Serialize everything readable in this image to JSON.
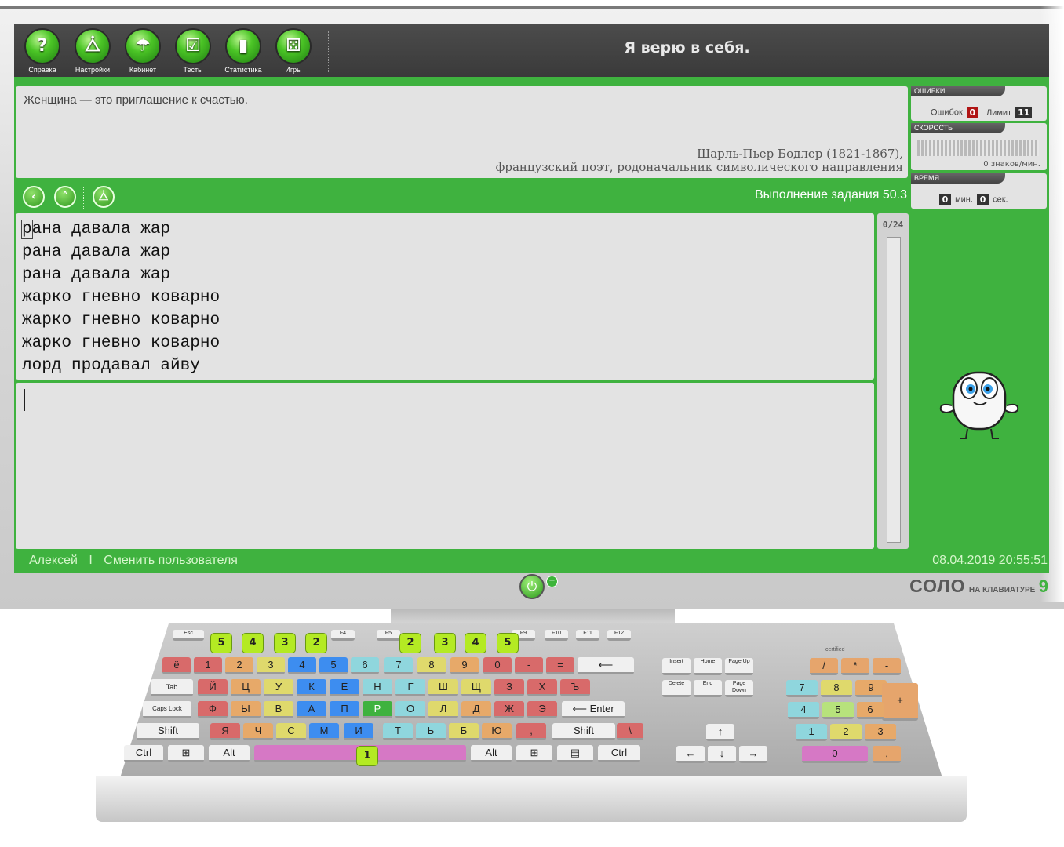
{
  "toolbar": {
    "items": [
      {
        "label": "Справка",
        "icon": "help-icon",
        "glyph": "?"
      },
      {
        "label": "Настройки",
        "icon": "metronome-icon",
        "glyph": "⧊"
      },
      {
        "label": "Кабинет",
        "icon": "lamp-icon",
        "glyph": "☂"
      },
      {
        "label": "Тесты",
        "icon": "test-check-icon",
        "glyph": "☑"
      },
      {
        "label": "Статистика",
        "icon": "chart-icon",
        "glyph": "▮"
      },
      {
        "label": "Игры",
        "icon": "dice-icon",
        "glyph": "⚄"
      }
    ],
    "motto": "Я верю в себя."
  },
  "quote": {
    "text": "Женщина — это приглашение к счастью.",
    "author_line1": "Шарль-Пьер Бодлер (1821-1867),",
    "author_line2": "французский поэт, родоначальник символического направления"
  },
  "panels": {
    "errors": {
      "title": "ОШИБКИ",
      "errors_label": "Ошибок",
      "errors_value": "0",
      "limit_label": "Лимит",
      "limit_value": "11"
    },
    "speed": {
      "title": "СКОРОСТЬ",
      "value_text": "0 знаков/мин."
    },
    "time": {
      "title": "ВРЕМЯ",
      "min_value": "0",
      "min_label": "мин.",
      "sec_value": "0",
      "sec_label": "сек."
    }
  },
  "task": {
    "progress_text": "Выполнение задания 50.3",
    "counter": "0/24",
    "lines": [
      "рана давала жар",
      "рана давала жар",
      "рана давала жар",
      "жарко гневно коварно",
      "жарко гневно коварно",
      "жарко гневно коварно",
      "лорд продавал айву"
    ],
    "first_char": "р",
    "first_line_rest": "ана давала жар"
  },
  "footer": {
    "user": "Алексей",
    "separator": "I",
    "change_user": "Сменить пользователя",
    "datetime": "08.04.2019 20:55:51"
  },
  "brand": {
    "name": "СОЛО",
    "sub": "НА КЛАВИАТУРЕ",
    "version": "9"
  },
  "keyboard": {
    "certified": "certified",
    "fingers": [
      "5",
      "4",
      "3",
      "2",
      "2",
      "3",
      "4",
      "5",
      "1"
    ],
    "row1": [
      "ё",
      "1",
      "2",
      "3",
      "4",
      "5",
      "6",
      "7",
      "8",
      "9",
      "0",
      "-",
      "="
    ],
    "row2": [
      "Й",
      "Ц",
      "У",
      "К",
      "Е",
      "Н",
      "Г",
      "Ш",
      "Щ",
      "З",
      "Х",
      "Ъ"
    ],
    "row3": [
      "Ф",
      "Ы",
      "В",
      "А",
      "П",
      "Р",
      "О",
      "Л",
      "Д",
      "Ж",
      "Э"
    ],
    "row4": [
      "Я",
      "Ч",
      "С",
      "М",
      "И",
      "Т",
      "Ь",
      "Б",
      "Ю",
      ",",
      "\\"
    ],
    "tab": "Tab",
    "caps": "Caps Lock",
    "shift_l": "Shift",
    "shift_r": "Shift",
    "enter": "Enter",
    "ctrl_l": "Ctrl",
    "alt_l": "Alt",
    "alt_r": "Alt",
    "ctrl_r": "Ctrl",
    "esc": "Esc",
    "fkeys": [
      "F4",
      "F5",
      "F9",
      "F10",
      "F11",
      "F12"
    ],
    "nav": [
      "Insert",
      "Home",
      "Page Up",
      "Delete",
      "End",
      "Page Down"
    ],
    "numpad": [
      "/",
      "*",
      "-",
      "7",
      "8",
      "9",
      "+",
      "4",
      "5",
      "6",
      "1",
      "2",
      "3",
      "0",
      ","
    ]
  },
  "colors": {
    "accent": "#3fb23f",
    "toolbar": "#444444",
    "panel": "#e3e3e3",
    "error_badge": "#b01515"
  }
}
